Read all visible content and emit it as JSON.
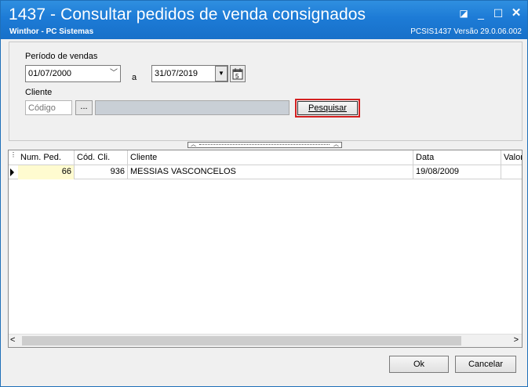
{
  "window": {
    "title": "1437 - Consultar pedidos de venda consignados",
    "company": "Winthor - PC Sistemas",
    "version_info": "PCSIS1437  Versão  29.0.06.002",
    "controls": {
      "restore": "◪",
      "minimize": "_",
      "maximize": "☐",
      "close": "✕"
    }
  },
  "filters": {
    "period_label": "Período de vendas",
    "date_from": "01/07/2000",
    "date_sep": "a",
    "date_to": "31/07/2019",
    "client_label": "Cliente",
    "client_code_placeholder": "Código",
    "ellipsis_label": "...",
    "search_label": "Pesquisar"
  },
  "grid": {
    "columns": [
      "Num. Ped.",
      "Cód. Cli.",
      "Cliente",
      "Data",
      "Valor"
    ],
    "rows": [
      {
        "num_ped": "66",
        "cod_cli": "936",
        "cliente": "MESSIAS VASCONCELOS",
        "data": "19/08/2009"
      }
    ]
  },
  "footer": {
    "ok_label": "Ok",
    "cancel_label": "Cancelar"
  },
  "colors": {
    "titlebar": "#1d7bd6",
    "highlight_border": "#d42020",
    "active_cell": "#fffbd0"
  }
}
